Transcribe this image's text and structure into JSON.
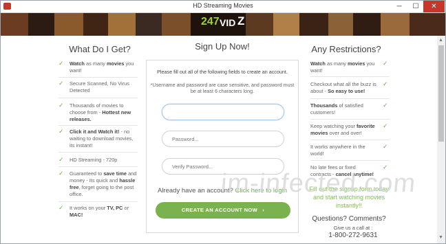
{
  "window": {
    "title": "HD Streaming Movies",
    "controls": {
      "minimize": "─",
      "maximize": "☐",
      "close": "✕"
    }
  },
  "logo": {
    "text_num": "247",
    "text_vid": "VID",
    "text_z": "Z"
  },
  "left": {
    "heading": "What Do I Get?",
    "items": [
      {
        "pre": "",
        "bold": "Watch",
        "mid": " as many ",
        "bold2": "movies",
        "post": " you want!"
      },
      {
        "pre": "Secure Scanned, No Virus Detected",
        "bold": "",
        "mid": "",
        "bold2": "",
        "post": ""
      },
      {
        "pre": "Thousands of movies to choose from - ",
        "bold": "Hottest new releases.",
        "mid": "",
        "bold2": "",
        "post": ""
      },
      {
        "pre": "",
        "bold": "Click it and Watch it!",
        "mid": " - no waiting to download movies, its instant!",
        "bold2": "",
        "post": ""
      },
      {
        "pre": "HD Streaming - 720p",
        "bold": "",
        "mid": "",
        "bold2": "",
        "post": ""
      },
      {
        "pre": "Guaranteed to ",
        "bold": "save time",
        "mid": " and money - Its quick and ",
        "bold2": "hassle free",
        "post": ", forget going to the post office."
      },
      {
        "pre": "It works on your ",
        "bold": "TV, PC",
        "mid": " or ",
        "bold2": "MAC!",
        "post": ""
      }
    ]
  },
  "center": {
    "heading": "Sign Up Now!",
    "intro": "Please fill out all of the following fields to create an account.",
    "note_line1": "*Username and password are case sensitive, and password must",
    "note_line2": "be at least 6 characters long.",
    "username_placeholder": "",
    "password_placeholder": "Password...",
    "verify_placeholder": "Verify Password...",
    "login_prompt": "Already have an account? ",
    "login_link": "Click here to login",
    "create_button": "CREATE AN ACCOUNT NOW",
    "create_arrow": "›"
  },
  "right": {
    "heading": "Any Restrictions?",
    "items": [
      {
        "pre": "",
        "bold": "Watch",
        "mid": " as many ",
        "bold2": "movies",
        "post": " you want!"
      },
      {
        "pre": "Checkout what all the buzz is about - ",
        "bold": "So easy to use!",
        "mid": "",
        "bold2": "",
        "post": ""
      },
      {
        "pre": "",
        "bold": "Thousands",
        "mid": " of satisfied customers!",
        "bold2": "",
        "post": ""
      },
      {
        "pre": "Keep watching your ",
        "bold": "favorite movies",
        "mid": " over and over!",
        "bold2": "",
        "post": ""
      },
      {
        "pre": "It works anywhere in the world!",
        "bold": "",
        "mid": "",
        "bold2": "",
        "post": ""
      },
      {
        "pre": "No late fees or fixed contracts - ",
        "bold": "cancel anytime!",
        "mid": "",
        "bold2": "",
        "post": ""
      }
    ],
    "promo": "Fill out the signup form today and start watching movies instantly!!",
    "questions": "Questions? Comments?",
    "call_us": "Give us a call at :",
    "phone": "1-800-272-9631"
  },
  "watermark": "im-infected.com",
  "colors": {
    "accent_green": "#79b24e",
    "check_green": "#6ab04c",
    "close_red": "#c7352b"
  }
}
